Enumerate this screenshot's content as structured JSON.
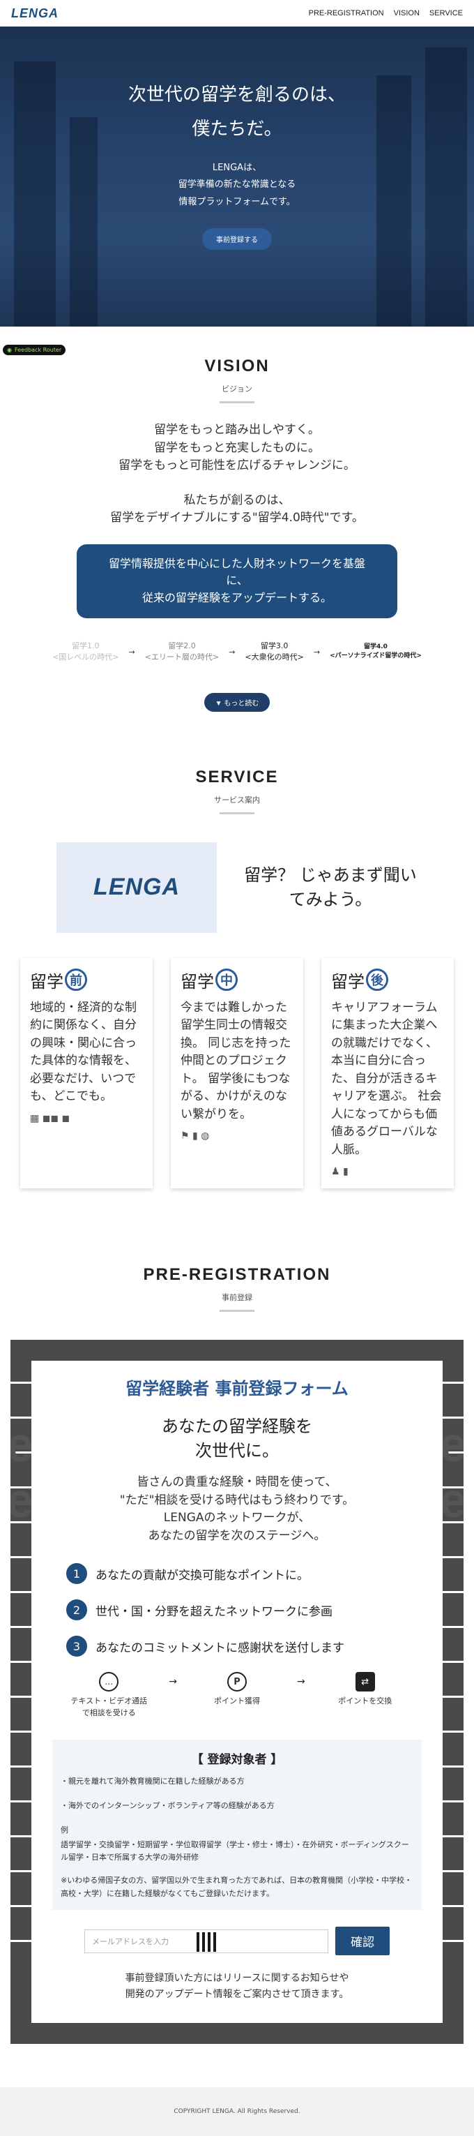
{
  "nav": {
    "logo": "LENGA",
    "links": [
      "PRE-REGISTRATION",
      "VISION",
      "SERVICE"
    ]
  },
  "hero": {
    "title_line1": "次世代の留学を創るのは、",
    "title_line2": "僕たちだ。",
    "desc_line1": "LENGAは、",
    "desc_line2": "留学準備の新たな常識となる",
    "desc_line3": "情報プラットフォームです。",
    "button": "事前登録する"
  },
  "feedback_badge": "Feedback Router",
  "vision": {
    "title": "VISION",
    "subtitle": "ビジョン",
    "text1": [
      "留学をもっと踏み出しやすく。",
      "留学をもっと充実したものに。",
      "留学をもっと可能性を広げるチャレンジに。"
    ],
    "text2": [
      "私たちが創るのは、",
      "留学をデザイナブルにする\"留学4.0時代\"です。"
    ],
    "box": [
      "留学情報提供を中心にした人財ネットワークを基盤",
      "に、",
      "従来の留学経験をアップデートする。"
    ],
    "timeline": [
      {
        "ver": "留学1.0",
        "desc": "<国レベルの時代>"
      },
      {
        "ver": "留学2.0",
        "desc": "<エリート層の時代>"
      },
      {
        "ver": "留学3.0",
        "desc": "<大衆化の時代>"
      },
      {
        "ver": "留学4.0",
        "desc": "<パーソナライズド留学の時代>"
      }
    ],
    "timeline_arrow": "→",
    "more_button": "▼ もっと読む"
  },
  "service": {
    "title": "SERVICE",
    "subtitle": "サービス案内",
    "logo": "LENGA",
    "catch": "留学？ じゃあまず聞いてみよう。",
    "cards": [
      {
        "prefix": "留学",
        "kanji": "前",
        "body": "地域的・経済的な制約に関係なく、自分の興味・関心に合った具体的な情報を、 必要なだけ、いつでも、どこでも。",
        "icons": "▦ ◼◼ ◼"
      },
      {
        "prefix": "留学",
        "kanji": "中",
        "body": "今までは難しかった留学生同士の情報交換。 同じ志を持った仲間とのプロジェクト。 留学後にもつながる、かけがえのない繋がりを。",
        "icons": "⚑ ▮ ◍"
      },
      {
        "prefix": "留学",
        "kanji": "後",
        "body": "キャリアフォーラムに集まった大企業への就職だけでなく、 本当に自分に合った、自分が活きるキャリアを選ぶ。 社会人になってからも価値あるグローバルな人脈。",
        "icons": "♟ ▮"
      }
    ]
  },
  "prereg": {
    "title": "PRE-REGISTRATION",
    "subtitle": "事前登録",
    "ghost_left": "e",
    "ghost_right": "e",
    "form_title": "留学経験者 事前登録フォーム",
    "form_sub_line1": "あなたの留学経験を",
    "form_sub_line2": "次世代に。",
    "desc_line1": "皆さんの貴重な経験・時間を使って、",
    "desc_line2": "\"ただ\"相談を受ける時代はもう終わりです。",
    "desc_line3": "LENGAのネットワークが、",
    "desc_line4": "あなたの留学を次のステージへ。",
    "steps": [
      {
        "num": "1",
        "text": "あなたの貢献が交換可能なポイントに。"
      },
      {
        "num": "2",
        "text": "世代・国・分野を超えたネットワークに参画"
      },
      {
        "num": "3",
        "text": "あなたのコミットメントに感謝状を送付します"
      }
    ],
    "flow": [
      {
        "icon": "…",
        "label": "テキスト・ビデオ通話で相談を受ける"
      },
      {
        "icon": "P",
        "label": "ポイント獲得"
      },
      {
        "icon": "⇄",
        "label": "ポイントを交換"
      }
    ],
    "flow_arrow": "→",
    "target_title": "【 登録対象者 】",
    "target_lines": [
      "・親元を離れて海外教育機関に在籍した経験がある方",
      "・海外でのインターンシップ・ボランティア等の経験がある方",
      "例",
      "語学留学・交換留学・短期留学・学位取得留学（学士・修士・博士）・在外研究・ボーディングスクール留学・日本で所属する大学の海外研修",
      "※いわゆる帰国子女の方、留学国以外で生まれ育った方であれば、日本の教育機関（小学校・中学校・高校・大学）に在籍した経験がなくてもご登録いただけます。"
    ],
    "email_placeholder": "メールアドレスを入力",
    "confirm_button": "確認",
    "note_line1": "事前登録頂いた方にはリリースに関するお知らせや",
    "note_line2": "開発のアップデート情報をご案内させて頂きます。"
  },
  "footer": "COPYRIGHT LENGA. All Rights Reserved."
}
